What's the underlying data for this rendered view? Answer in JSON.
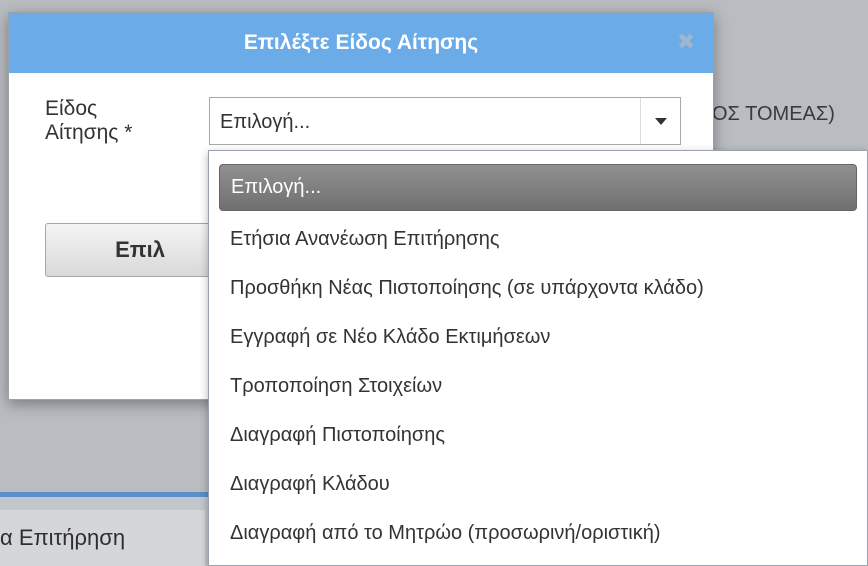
{
  "background": {
    "right_text": "ΟΣ ΤΟΜΕΑΣ)",
    "bottom_tab_label": "α Επιτήρηση"
  },
  "modal": {
    "title": "Επιλέξτε Είδος Αίτησης",
    "close_icon": "close-icon",
    "field_label_line1": "Είδος",
    "field_label_line2": "Αίτησης *",
    "select_value": "Επιλογή...",
    "button_label": "Επιλ"
  },
  "dropdown": {
    "options": [
      "Επιλογή...",
      "Ετήσια Ανανέωση Επιτήρησης",
      "Προσθήκη Νέας Πιστοποίησης (σε υπάρχοντα κλάδο)",
      "Εγγραφή σε Νέο Κλάδο Εκτιμήσεων",
      "Τροποποίηση Στοιχείων",
      "Διαγραφή Πιστοποίησης",
      "Διαγραφή Κλάδου",
      "Διαγραφή από το Μητρώο (προσωρινή/οριστική)"
    ]
  },
  "colors": {
    "header": "#6aabe8",
    "selected_option": "#808080",
    "overlay": "#b9bcc0"
  }
}
